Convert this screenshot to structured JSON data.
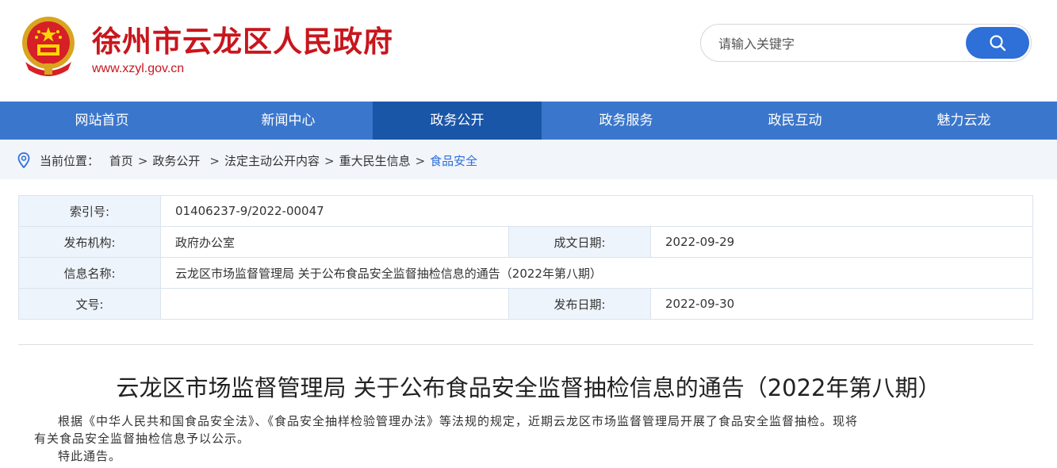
{
  "site": {
    "title": "徐州市云龙区人民政府",
    "url": "www.xzyl.gov.cn",
    "brand_color": "#c8161d"
  },
  "search": {
    "placeholder": "请输入关键字",
    "button_icon": "search-icon"
  },
  "nav": {
    "items": [
      "网站首页",
      "新闻中心",
      "政务公开",
      "政务服务",
      "政民互动",
      "魅力云龙"
    ],
    "active": "政务公开",
    "color": "#3a77cc",
    "active_color": "#1a56a8"
  },
  "breadcrumb": {
    "label": "当前位置：",
    "items": [
      "首页",
      "政务公开",
      "法定主动公开内容",
      "重大民生信息",
      "食品安全"
    ]
  },
  "meta": {
    "index_label": "索引号:",
    "index_value": "01406237-9/2022-00047",
    "publisher_label": "发布机构:",
    "publisher_value": "政府办公室",
    "created_label": "成文日期:",
    "created_value": "2022-09-29",
    "name_label": "信息名称:",
    "name_value": "云龙区市场监督管理局 关于公布食品安全监督抽检信息的通告（2022年第八期）",
    "docno_label": "文号:",
    "docno_value": "",
    "published_label": "发布日期:",
    "published_value": "2022-09-30"
  },
  "document": {
    "title": "云龙区市场监督管理局 关于公布食品安全监督抽检信息的通告（2022年第八期）",
    "para1_line1": "根据《中华人民共和国食品安全法》、《食品安全抽样检验管理办法》等法规的规定，近期云龙区市场监督管理局开展了食品安全监督抽检。现将",
    "para1_line2": "有关食品安全监督抽检信息予以公示。",
    "para2": "特此通告。"
  }
}
